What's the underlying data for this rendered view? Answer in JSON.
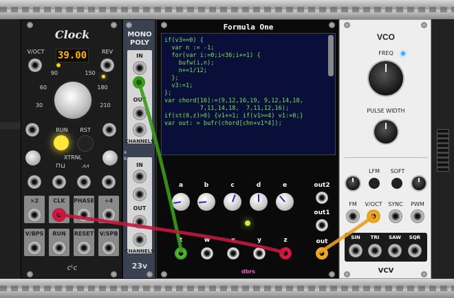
{
  "clock": {
    "title": "Clock",
    "voct_label": "V/OCT",
    "bpm_display": "39.00",
    "rev_label": "REV",
    "dial_ticks": [
      "90",
      "150",
      "60",
      "180",
      "30",
      "210"
    ],
    "run_label": "RUN",
    "rst_label": "RST",
    "xtrnl_label": "XTRNL",
    "wave_label_1": "⊓⊔",
    "wave_label_2": "⩘⩘",
    "grid_labels": [
      "×2",
      "CLK",
      "PHASE",
      "÷4",
      "V/BPS",
      "RUN",
      "RESET",
      "V/SPB"
    ],
    "brand": "ᴄᴸᴄ"
  },
  "monopoly": {
    "title_line1": "MONO",
    "title_line2": "POLY",
    "in_label": "IN",
    "out_label": "OUT",
    "channels_label": "CHANNELS",
    "brand": "23v",
    "a_label": "A",
    "b_label": "B"
  },
  "formula": {
    "title": "Formula One",
    "code": "if(v3==0) {\n  var n := -1;\n  for(var i:=0;i<36;i+=1) {\n    bufw(i,n);\n    n+=1/12;\n  };\n  v3:=1;\n};\nvar chord[16]:=(9,12,16,19, 9,12,14,18,\n          7,11,14,18,  7,11,12,16);\nif(st(0,z)>0) {v1+=1; if(v1>=4) v1:=0;}\nvar out: = bufr(chord[chn+v1*4]);",
    "knob_labels": [
      "a",
      "b",
      "c",
      "d",
      "e"
    ],
    "jack_labels": [
      "t",
      "w",
      "x",
      "y",
      "z"
    ],
    "out_labels": [
      "out2",
      "out1",
      "out"
    ],
    "brand": "dbrs"
  },
  "vco": {
    "title": "VCO",
    "freq_label": "FREQ",
    "pw_label": "PULSE WIDTH",
    "lfm_label": "LFM",
    "soft_label": "SOFT",
    "input_labels": [
      "FM",
      "V/OCT",
      "SYNC",
      "PWM"
    ],
    "output_labels": [
      "SIN",
      "TRI",
      "SAW",
      "SQR"
    ],
    "brand": "VCV"
  },
  "colors": {
    "cable_green": "#3a9a1a",
    "cable_red": "#c0183a",
    "cable_orange": "#e8a020",
    "led_yellow": "#ffe23a",
    "display_amber": "#ffb400",
    "code_green": "#6ee65a"
  }
}
